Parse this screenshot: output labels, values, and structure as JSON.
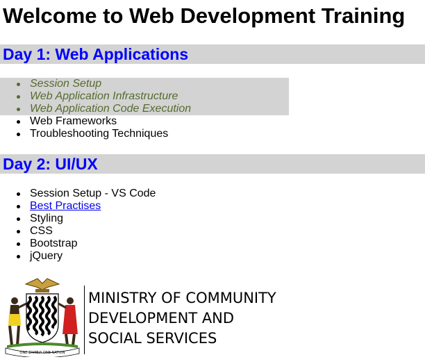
{
  "page": {
    "title": "Welcome to Web Development Training"
  },
  "day1": {
    "heading": "Day 1: Web Applications",
    "items": [
      {
        "label": "Session Setup"
      },
      {
        "label": "Web Application Infrastructure"
      },
      {
        "label": "Web Application Code Execution"
      },
      {
        "label": "Web Frameworks"
      },
      {
        "label": "Troubleshooting Techniques"
      }
    ]
  },
  "day2": {
    "heading": "Day 2: UI/UX",
    "items": [
      {
        "label": "Session Setup - VS Code"
      },
      {
        "label": "Best Practises",
        "is_link": true
      },
      {
        "label": "Styling"
      },
      {
        "label": "CSS"
      },
      {
        "label": "Bootstrap"
      },
      {
        "label": "jQuery"
      }
    ]
  },
  "ministry_logo": {
    "line1": "MINISTRY OF COMMUNITY",
    "line2": "DEVELOPMENT AND",
    "line3": "SOCIAL SERVICES",
    "emblem_motto": "ONE ZAMBIA ONE NATION"
  },
  "colors": {
    "heading_text": "#0000ff",
    "heading_bg": "#d3d3d3",
    "highlight_text": "#556b2f",
    "link": "#0000ee"
  },
  "icons": {
    "emblem": "zambia-coat-of-arms-icon"
  }
}
